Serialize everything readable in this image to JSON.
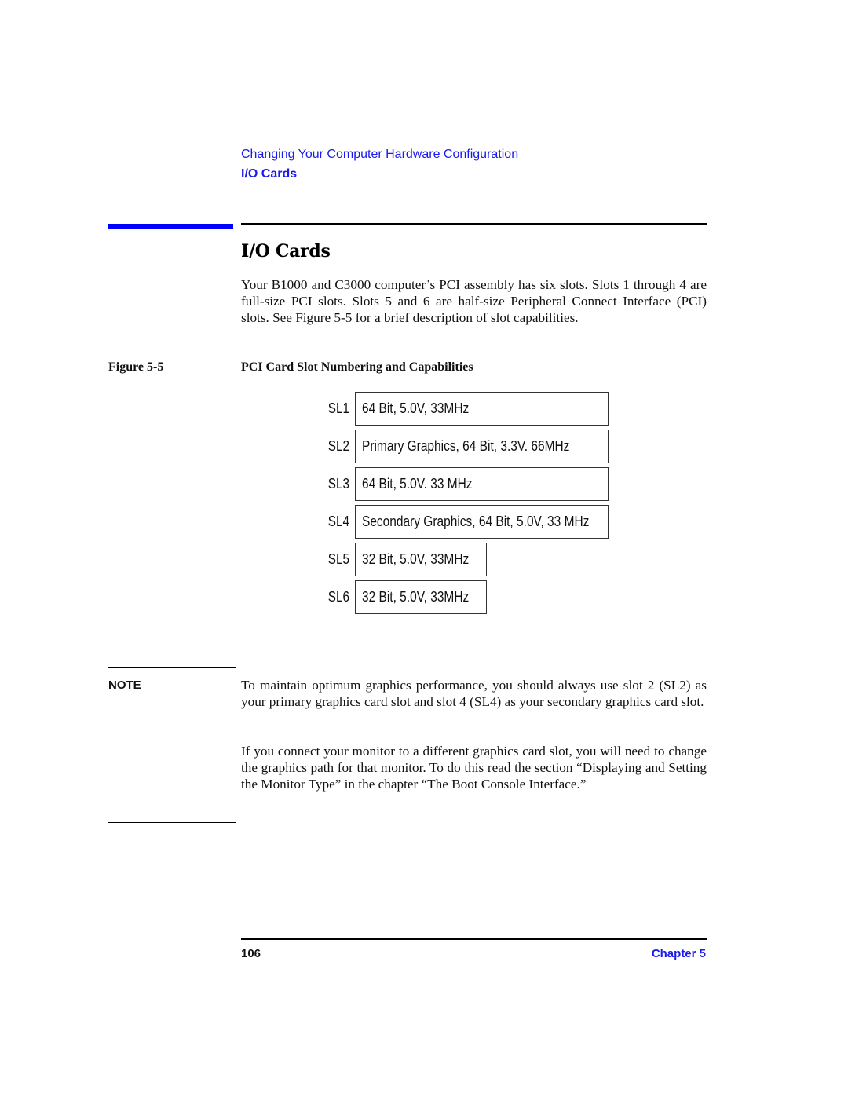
{
  "running_header": {
    "chapter_title": "Changing Your Computer Hardware Configuration",
    "section_title": "I/O Cards"
  },
  "section": {
    "title": "I/O Cards",
    "intro": "Your B1000 and C3000 computer’s PCI assembly has six slots. Slots 1 through 4 are full-size PCI slots. Slots 5 and 6 are half-size Peripheral Connect Interface (PCI) slots. See Figure 5-5 for a brief description of slot capabilities."
  },
  "figure": {
    "label": "Figure 5-5",
    "title": "PCI Card Slot Numbering and Capabilities",
    "slots": [
      {
        "id": "SL1",
        "description": "64 Bit, 5.0V, 33MHz",
        "size": "full"
      },
      {
        "id": "SL2",
        "description": "Primary Graphics, 64 Bit, 3.3V. 66MHz",
        "size": "full"
      },
      {
        "id": "SL3",
        "description": "64 Bit, 5.0V. 33 MHz",
        "size": "full"
      },
      {
        "id": "SL4",
        "description": "Secondary Graphics, 64 Bit, 5.0V, 33 MHz",
        "size": "full"
      },
      {
        "id": "SL5",
        "description": "32 Bit, 5.0V, 33MHz",
        "size": "half"
      },
      {
        "id": "SL6",
        "description": "32 Bit, 5.0V, 33MHz",
        "size": "half"
      }
    ]
  },
  "note": {
    "label": "NOTE",
    "paragraphs": [
      "To maintain optimum graphics performance, you should always use slot 2 (SL2) as your primary graphics card slot and slot 4 (SL4) as your secondary graphics card slot.",
      "If you connect your monitor to a different graphics card slot, you will need to change the graphics path for that monitor. To do this read the section “Displaying and Setting the Monitor Type” in the chapter “The Boot Console Interface.”"
    ]
  },
  "footer": {
    "page_number": "106",
    "chapter": "Chapter 5"
  },
  "colors": {
    "accent_blue": "#0000ff",
    "header_text_blue": "#1a1aee"
  }
}
